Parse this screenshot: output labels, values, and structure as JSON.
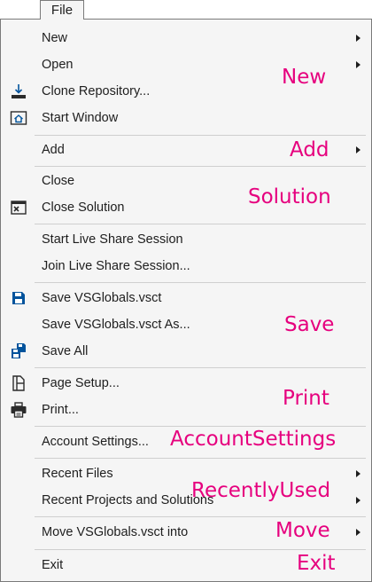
{
  "tab": {
    "label": "File"
  },
  "menu": {
    "new": "New",
    "open": "Open",
    "clone_repository": "Clone Repository...",
    "start_window": "Start Window",
    "add": "Add",
    "close": "Close",
    "close_solution": "Close Solution",
    "start_live_share": "Start Live Share Session",
    "join_live_share": "Join Live Share Session...",
    "save": "Save VSGlobals.vsct",
    "save_as": "Save VSGlobals.vsct As...",
    "save_all": "Save All",
    "page_setup": "Page Setup...",
    "print": "Print...",
    "account_settings": "Account Settings...",
    "recent_files": "Recent Files",
    "recent_projects": "Recent Projects and Solutions",
    "move_into": "Move VSGlobals.vsct into",
    "exit": "Exit"
  },
  "group_labels": {
    "new": "New",
    "add": "Add",
    "solution": "Solution",
    "save": "Save",
    "print": "Print",
    "account_settings": "AccountSettings",
    "recently_used": "RecentlyUsed",
    "move": "Move",
    "exit": "Exit"
  },
  "icons": {
    "clone_repository": "clone-repository-icon",
    "start_window": "start-window-icon",
    "close_solution": "close-solution-icon",
    "save": "save-icon",
    "save_all": "save-all-icon",
    "page_setup": "page-setup-icon",
    "print": "printer-icon"
  },
  "colors": {
    "group_label": "#e6007e",
    "menu_background": "#f5f5f5",
    "icon_blue": "#00539c"
  }
}
